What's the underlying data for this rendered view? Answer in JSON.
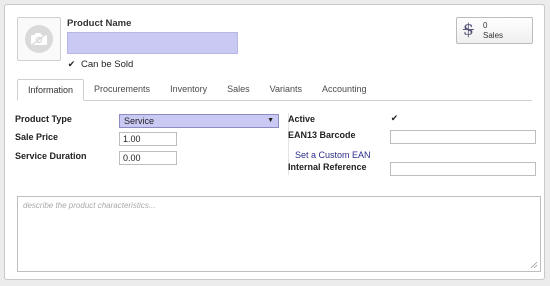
{
  "product": {
    "name_label": "Product Name",
    "name_value": "",
    "can_be_sold_label": "Can be Sold",
    "can_be_sold_checked": true
  },
  "smart_button": {
    "icon": "dollar-icon",
    "count": "0",
    "label": "Sales"
  },
  "tabs": [
    {
      "label": "Information",
      "active": true
    },
    {
      "label": "Procurements",
      "active": false
    },
    {
      "label": "Inventory",
      "active": false
    },
    {
      "label": "Sales",
      "active": false
    },
    {
      "label": "Variants",
      "active": false
    },
    {
      "label": "Accounting",
      "active": false
    }
  ],
  "info": {
    "product_type_label": "Product Type",
    "product_type_value": "Service",
    "sale_price_label": "Sale Price",
    "sale_price_value": "1.00",
    "service_duration_label": "Service Duration",
    "service_duration_value": "0.00",
    "active_label": "Active",
    "active_checked": true,
    "ean13_label": "EAN13 Barcode",
    "ean13_value": "",
    "set_custom_ean_label": "Set a Custom EAN",
    "internal_reference_label": "Internal Reference",
    "internal_reference_value": ""
  },
  "description": {
    "placeholder": "describe the product characteristics..."
  },
  "colors": {
    "required_field_bg": "#c9c9f3",
    "link": "#2d2d8c"
  }
}
